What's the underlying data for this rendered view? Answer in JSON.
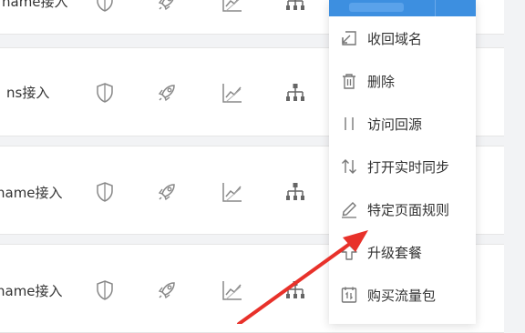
{
  "rows": [
    {
      "access": "name接入"
    },
    {
      "access": "ns接入"
    },
    {
      "access": "name接入"
    },
    {
      "access": "name接入"
    }
  ],
  "row_icons": [
    "shield-icon",
    "rocket-icon",
    "chart-icon",
    "sitemap-icon"
  ],
  "menu": {
    "items": [
      {
        "label": "收回域名",
        "icon": "reclaim-icon"
      },
      {
        "label": "删除",
        "icon": "trash-icon"
      },
      {
        "label": "访问回源",
        "icon": "origin-icon"
      },
      {
        "label": "打开实时同步",
        "icon": "sync-icon"
      },
      {
        "label": "特定页面规则",
        "icon": "pencil-icon"
      },
      {
        "label": "升级套餐",
        "icon": "upgrade-icon"
      },
      {
        "label": "购买流量包",
        "icon": "traffic-pack-icon"
      }
    ]
  },
  "colors": {
    "accent": "#3d8fe0",
    "annotation_arrow": "#e8312a",
    "icon_gray": "#888888"
  }
}
